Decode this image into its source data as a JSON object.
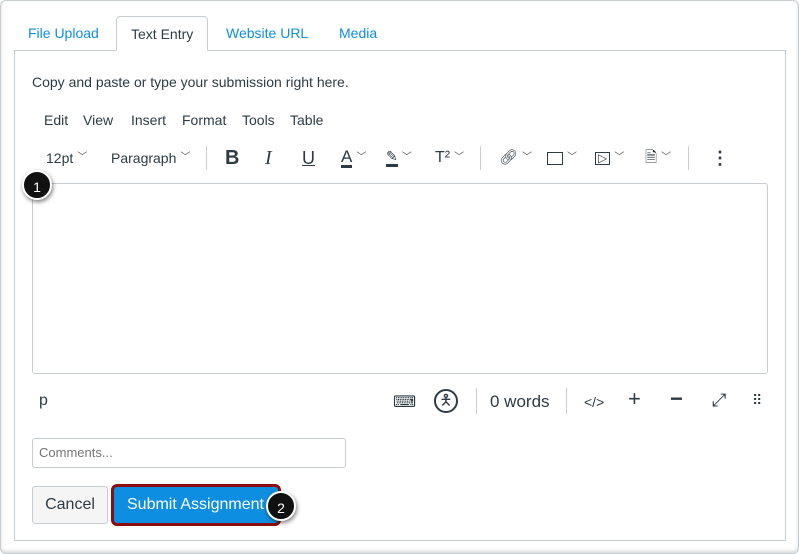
{
  "tabs": [
    {
      "label": "File Upload"
    },
    {
      "label": "Text Entry"
    },
    {
      "label": "Website URL"
    },
    {
      "label": "Media"
    }
  ],
  "instructions": "Copy and paste or type your submission right here.",
  "menu": [
    "Edit",
    "View",
    "Insert",
    "Format",
    "Tools",
    "Table"
  ],
  "toolbar": {
    "font_size": "12pt",
    "block_format": "Paragraph",
    "bold": "B",
    "italic": "I",
    "underline": "U",
    "font_color": "A",
    "superscript": "T²",
    "more": "⋮"
  },
  "callouts": {
    "one": "1",
    "two": "2"
  },
  "status_bar": {
    "element_path": "p",
    "word_count": "0 words",
    "html_toggle": "</>"
  },
  "comments": {
    "placeholder": "Comments..."
  },
  "buttons": {
    "cancel": "Cancel",
    "submit": "Submit Assignment"
  },
  "colors": {
    "link": "#0e8ee0",
    "submit": "#0e8ee0",
    "highlight": "#8b0d0d"
  }
}
